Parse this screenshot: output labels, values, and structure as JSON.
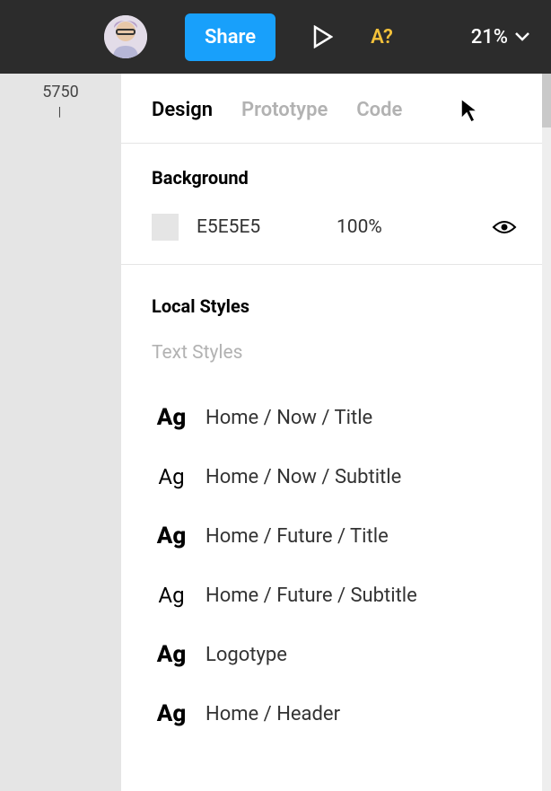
{
  "topbar": {
    "share_label": "Share",
    "missing_font_label": "A?",
    "zoom_label": "21%"
  },
  "ruler": {
    "value": "5750",
    "tick": "|"
  },
  "tabs": [
    {
      "label": "Design",
      "active": true
    },
    {
      "label": "Prototype",
      "active": false
    },
    {
      "label": "Code",
      "active": false
    }
  ],
  "background": {
    "title": "Background",
    "hex": "E5E5E5",
    "opacity": "100%",
    "swatch_color": "#e5e5e5"
  },
  "local_styles": {
    "title": "Local Styles",
    "subheader": "Text Styles",
    "items": [
      {
        "preview_weight": "bold",
        "name": "Home / Now / Title"
      },
      {
        "preview_weight": "regular",
        "name": "Home / Now / Subtitle"
      },
      {
        "preview_weight": "bold",
        "name": "Home / Future / Title"
      },
      {
        "preview_weight": "regular",
        "name": "Home / Future / Subtitle"
      },
      {
        "preview_weight": "bold",
        "name": "Logotype"
      },
      {
        "preview_weight": "bold",
        "name": "Home / Header"
      }
    ]
  },
  "glyphs": {
    "ag": "Ag"
  }
}
